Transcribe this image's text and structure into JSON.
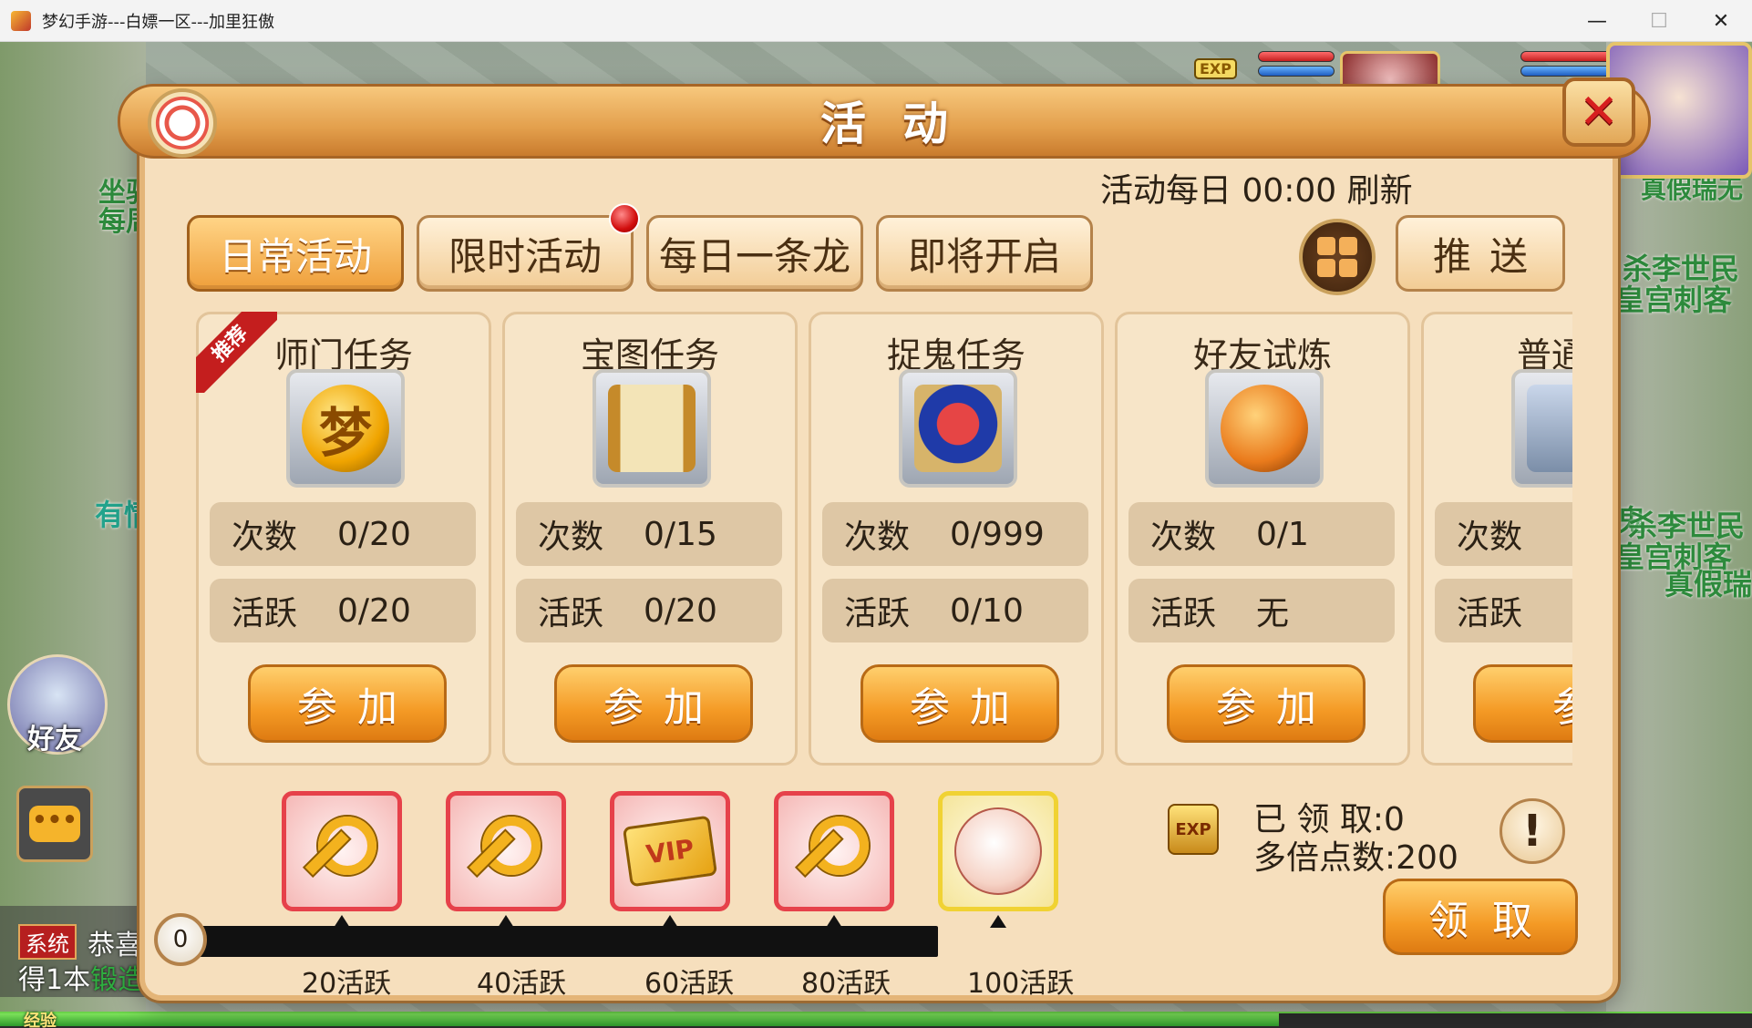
{
  "window": {
    "title": "梦幻手游---白嫖一区---加里狂傲",
    "minimize": "—",
    "maximize": "☐",
    "close": "✕"
  },
  "background": {
    "left_texts": [
      "坐骑",
      "每周",
      "有情"
    ],
    "right_texts": [
      "真假瑞无",
      "杀李世民",
      "皇宫刺客",
      "鬼",
      "杀李世民",
      "皇宫刺客",
      "真假瑞"
    ],
    "friend_label": "好友",
    "system_badge": "系统",
    "system_msg_1": "恭喜",
    "system_msg_2_prefix": "得1本",
    "system_msg_2_green": "锻造",
    "exp_label": "经验",
    "exp_icon": "EXP",
    "chat_icon": "chat-bubble-icon",
    "exp_progress": 0.73
  },
  "dialog": {
    "title": "活动",
    "refresh_note": "活动每日 00:00 刷新",
    "tabs": [
      {
        "label": "日常活动",
        "active": true
      },
      {
        "label": "限时活动",
        "has_dot": true
      },
      {
        "label": "每日一条龙"
      },
      {
        "label": "即将开启"
      }
    ],
    "push_label": "推送",
    "grid_icon": "grid-menu-icon",
    "close_icon": "close-x-icon"
  },
  "cards": [
    {
      "title": "师门任务",
      "recommended": "推荐",
      "icon": "dream-coin-icon",
      "count_label": "次数",
      "count": "0/20",
      "active_label": "活跃",
      "active": "0/20",
      "button": "参加"
    },
    {
      "title": "宝图任务",
      "icon": "treasure-map-icon",
      "count_label": "次数",
      "count": "0/15",
      "active_label": "活跃",
      "active": "0/20",
      "button": "参加"
    },
    {
      "title": "捉鬼任务",
      "icon": "ghost-mask-icon",
      "count_label": "次数",
      "count": "0/999",
      "active_label": "活跃",
      "active": "0/10",
      "button": "参加"
    },
    {
      "title": "好友试炼",
      "icon": "lantern-icon",
      "count_label": "次数",
      "count": "0/1",
      "active_label": "活跃",
      "active": "无",
      "button": "参加"
    },
    {
      "title": "普通挑",
      "icon": "treasure-chest-icon",
      "count_label": "次数",
      "count": "",
      "active_label": "活跃",
      "active": "",
      "button": "参"
    }
  ],
  "rewards": {
    "progress_value": "0",
    "milestones": [
      "20活跃",
      "40活跃",
      "60活跃",
      "80活跃",
      "100活跃"
    ],
    "items": [
      {
        "icon": "gold-key-icon"
      },
      {
        "icon": "gold-key-icon"
      },
      {
        "icon": "vip-card-icon",
        "text": "VIP"
      },
      {
        "icon": "gold-key-icon"
      },
      {
        "icon": "lucky-bag-icon"
      }
    ],
    "exp_icon_text": "EXP",
    "claimed": "已 领 取:0",
    "multiplier": "多倍点数:200",
    "info": "!",
    "claim_button": "领取"
  }
}
